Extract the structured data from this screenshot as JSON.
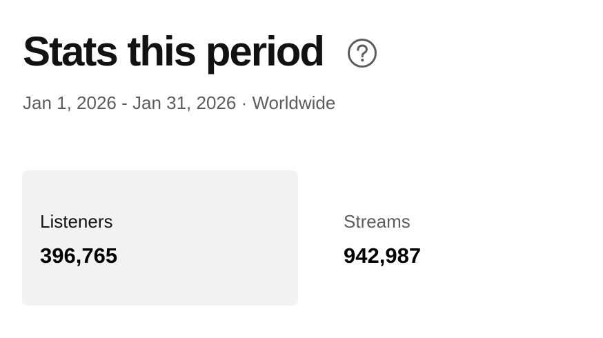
{
  "header": {
    "title": "Stats this period",
    "help_icon": "question-circle"
  },
  "subtitle": "Jan 1, 2026 - Jan 31, 2026 · Worldwide",
  "stats": [
    {
      "label": "Listeners",
      "value": "396,765",
      "selected": true
    },
    {
      "label": "Streams",
      "value": "942,987",
      "selected": false
    }
  ],
  "colors": {
    "text_primary": "#121212",
    "text_secondary": "#5c5c5c",
    "card_selected_bg": "#f2f2f2"
  }
}
